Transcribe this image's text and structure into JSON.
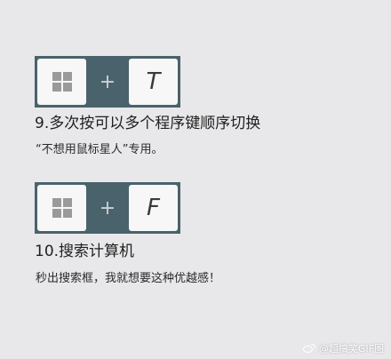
{
  "shortcuts": [
    {
      "icon": "windows-logo-icon",
      "plus": "+",
      "key": "T",
      "title": "9.多次按可以多个程序键顺序切换",
      "description": "“不想用鼠标星人”专用。"
    },
    {
      "icon": "windows-logo-icon",
      "plus": "+",
      "key": "F",
      "title": "10.搜索计算机",
      "description": "秒出搜索框，我就想要这种优越感！"
    }
  ],
  "watermark": {
    "icon": "weibo-icon",
    "text": "@超搞笑GIF图"
  },
  "colors": {
    "background": "#e8e8ea",
    "combo": "#4a626b",
    "key": "#f7f7f7"
  }
}
